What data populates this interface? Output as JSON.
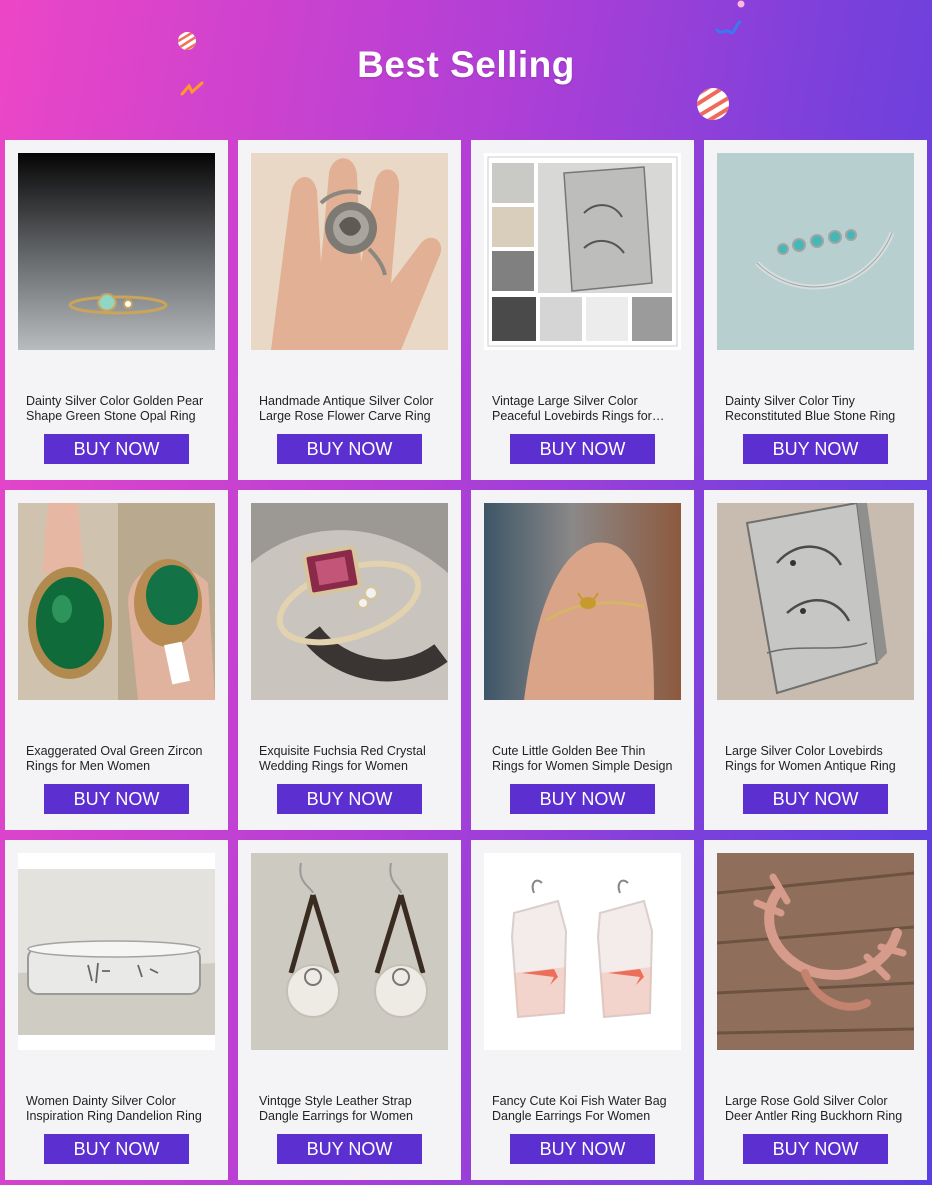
{
  "header": {
    "title": "Best Selling"
  },
  "colors": {
    "button_bg": "#5b2fd0",
    "card_bg": "#f4f4f6",
    "gradient_left": "#ec46c6",
    "gradient_right": "#5a3fe0"
  },
  "products": [
    {
      "name": "Dainty Silver Color Golden Pear Shape Green Stone Opal Ring",
      "button": "BUY NOW",
      "image": "gold-ring-green-pear-stone"
    },
    {
      "name": "Handmade Antique Silver Color Large Rose Flower Carve Ring",
      "button": "BUY NOW",
      "image": "silver-rose-ring-on-finger"
    },
    {
      "name": "Vintage Large Silver Color Peaceful Lovebirds Rings for Women",
      "button": "BUY NOW",
      "image": "lovebirds-ring-collage"
    },
    {
      "name": "Dainty Silver Color Tiny Reconstituted Blue Stone Ring",
      "button": "BUY NOW",
      "image": "turquoise-band-ring"
    },
    {
      "name": "Exaggerated Oval Green Zircon Rings for Men Women",
      "button": "BUY NOW",
      "image": "green-oval-zircon-ring"
    },
    {
      "name": "Exquisite Fuchsia Red Crystal Wedding Rings for Women",
      "button": "BUY NOW",
      "image": "fuchsia-crystal-ring"
    },
    {
      "name": "Cute Little Golden Bee Thin Rings for Women Simple Design",
      "button": "BUY NOW",
      "image": "gold-bee-ring-on-finger"
    },
    {
      "name": "Large Silver Color Lovebirds Rings for Women Antique Ring",
      "button": "BUY NOW",
      "image": "lovebirds-ring"
    },
    {
      "name": "Women Dainty Silver Color Inspiration Ring Dandelion Ring",
      "button": "BUY NOW",
      "image": "engraved-silver-band"
    },
    {
      "name": "Vintqge Style Leather Strap Dangle Earrings for Women",
      "button": "BUY NOW",
      "image": "leather-pearl-earrings"
    },
    {
      "name": "Fancy Cute Koi Fish Water Bag Dangle Earrings For Women",
      "button": "BUY NOW",
      "image": "koi-fish-bag-earrings"
    },
    {
      "name": "Large Rose Gold Silver Color Deer Antler Ring Buckhorn Ring",
      "button": "BUY NOW",
      "image": "rose-gold-antler-ring"
    }
  ]
}
